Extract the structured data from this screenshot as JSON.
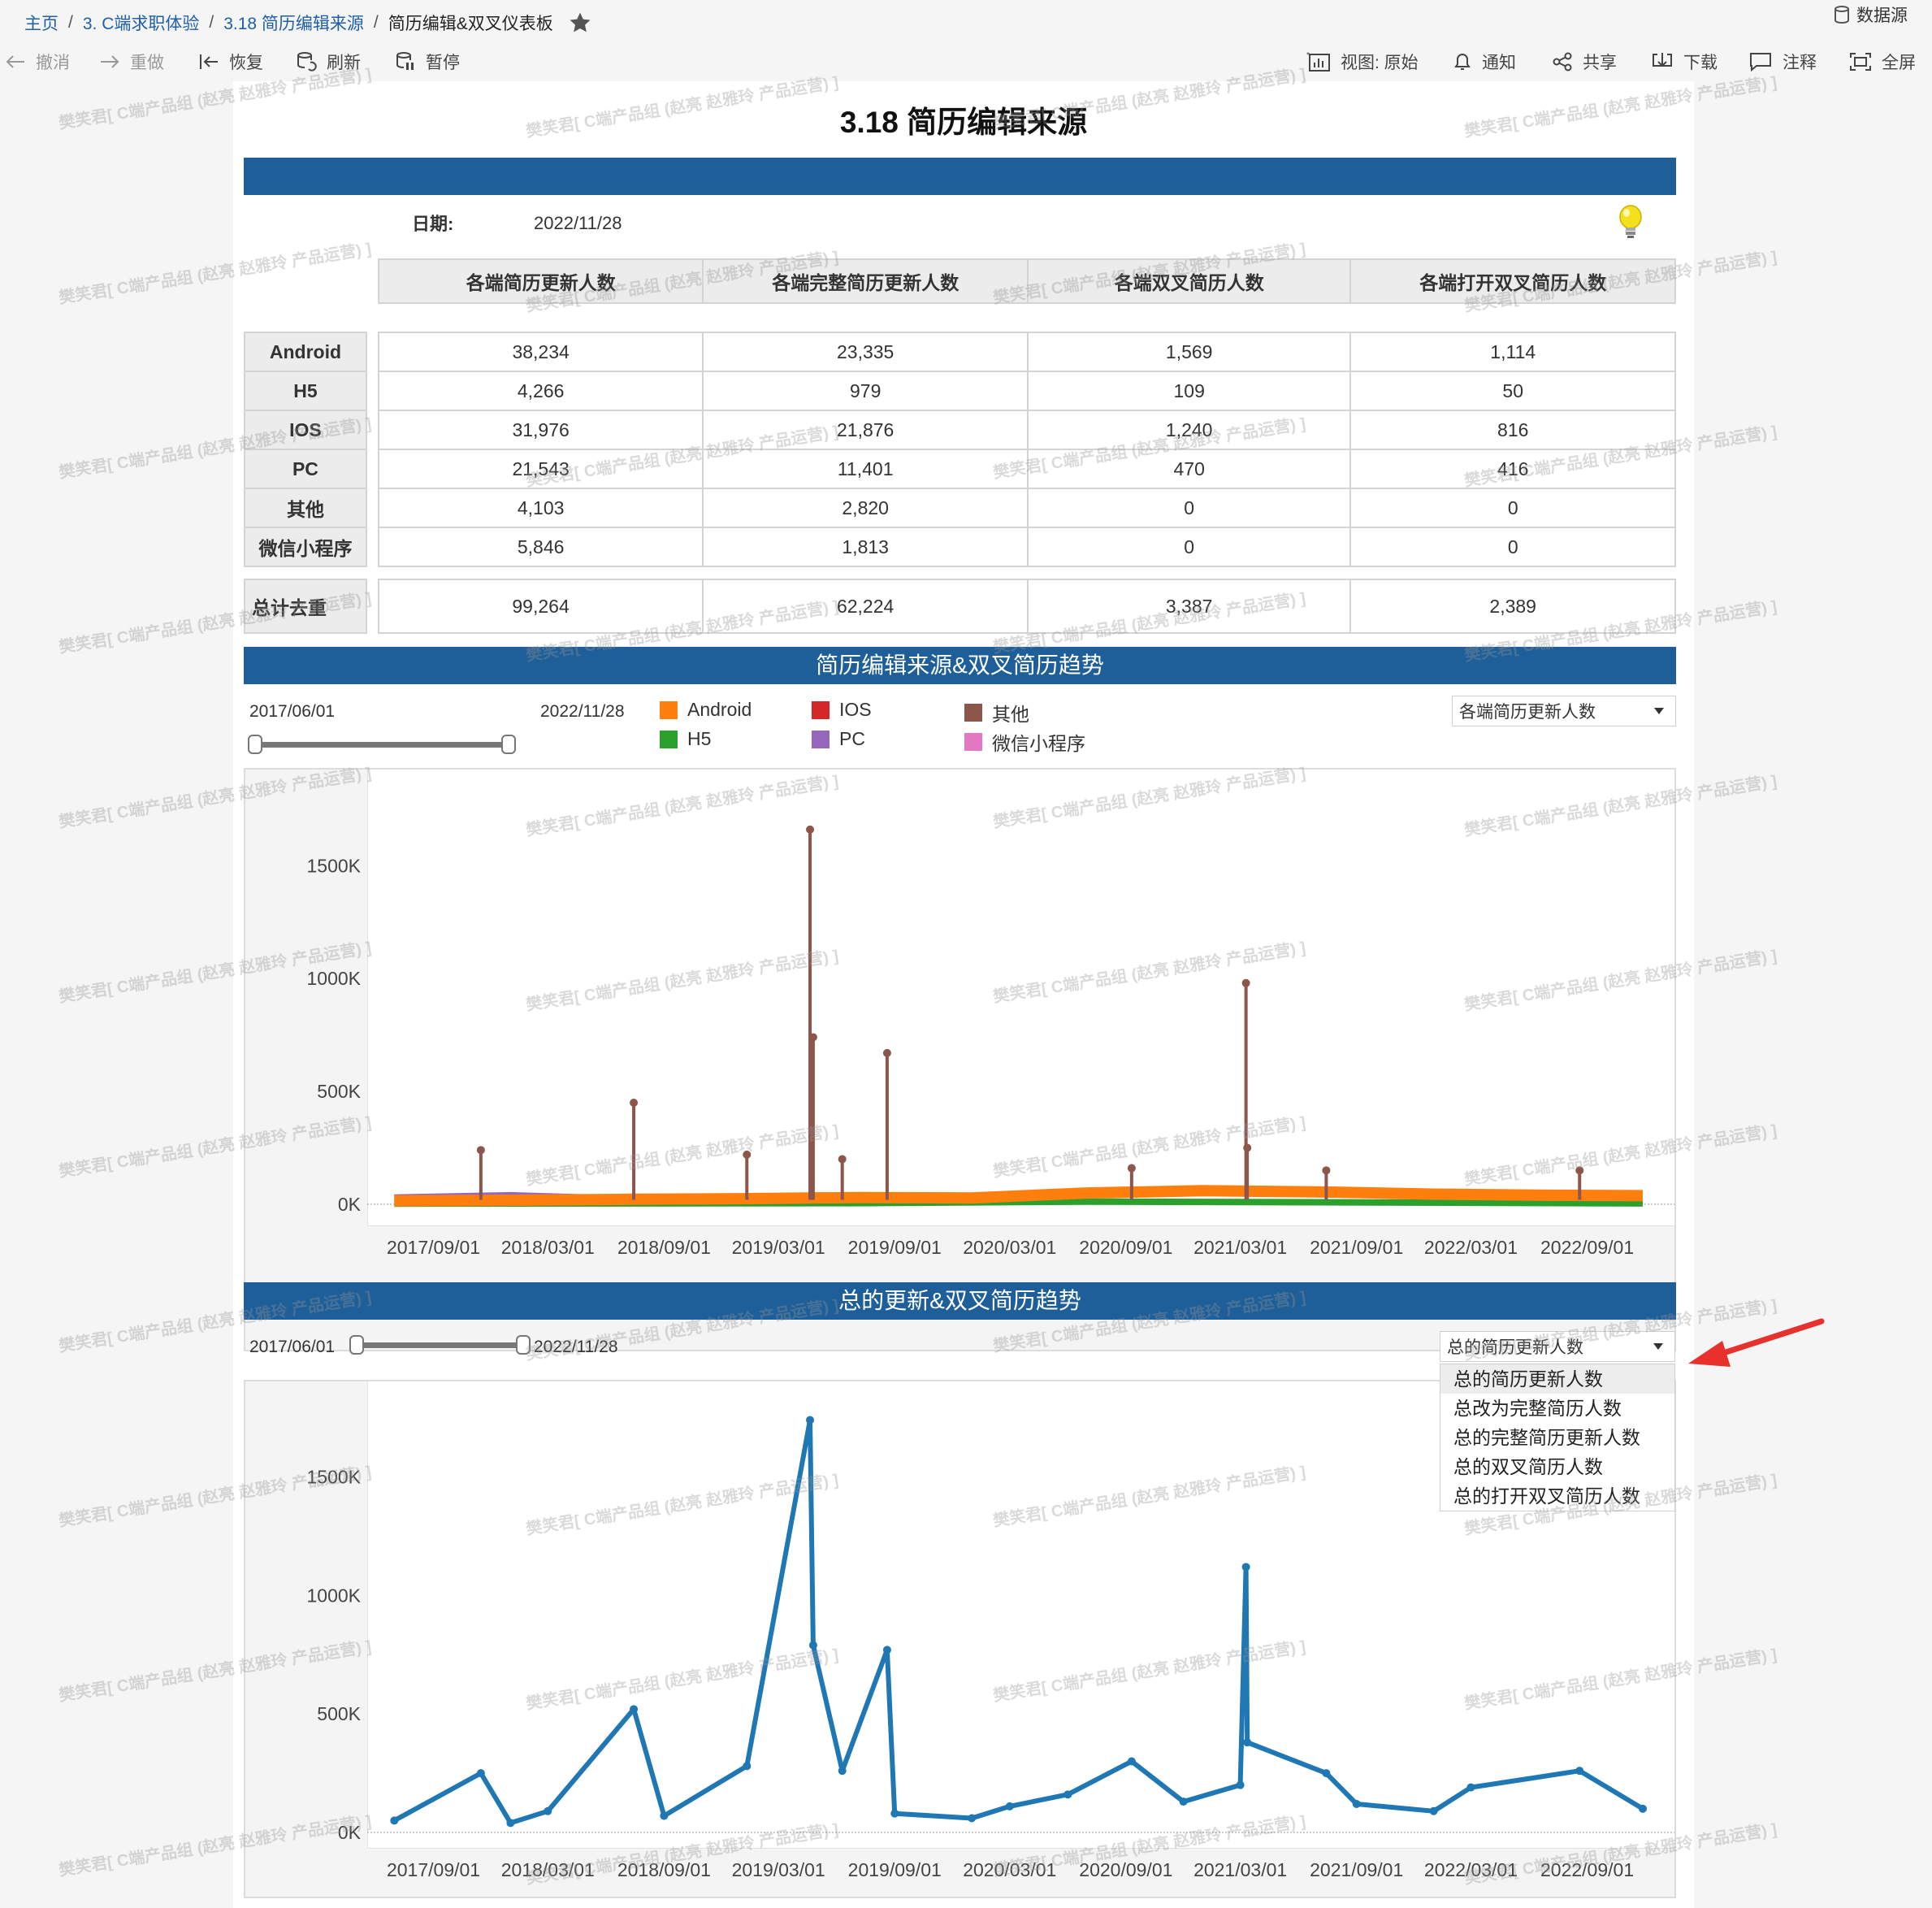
{
  "breadcrumb": {
    "items": [
      "主页",
      "3. C端求职体验",
      "3.18 简历编辑来源"
    ],
    "current": "简历编辑&双叉仪表板",
    "separator": "/"
  },
  "datasource_label": "数据源",
  "toolbar": {
    "undo": "撤消",
    "redo": "重做",
    "revert": "恢复",
    "refresh": "刷新",
    "pause": "暂停",
    "view": "视图: 原始",
    "notify": "通知",
    "share": "共享",
    "download": "下载",
    "comment": "注释",
    "fullscreen": "全屏"
  },
  "dashboard": {
    "title": "3.18 简历编辑来源",
    "date_label": "日期:",
    "date_value": "2022/11/28"
  },
  "kpi_table": {
    "columns": [
      "各端简历更新人数",
      "各端完整简历更新人数",
      "各端双叉简历人数",
      "各端打开双叉简历人数"
    ],
    "rows": [
      {
        "label": "Android",
        "values": [
          "38,234",
          "23,335",
          "1,569",
          "1,114"
        ]
      },
      {
        "label": "H5",
        "values": [
          "4,266",
          "979",
          "109",
          "50"
        ]
      },
      {
        "label": "IOS",
        "values": [
          "31,976",
          "21,876",
          "1,240",
          "816"
        ]
      },
      {
        "label": "PC",
        "values": [
          "21,543",
          "11,401",
          "470",
          "416"
        ]
      },
      {
        "label": "其他",
        "values": [
          "4,103",
          "2,820",
          "0",
          "0"
        ]
      },
      {
        "label": "微信小程序",
        "values": [
          "5,846",
          "1,813",
          "0",
          "0"
        ]
      }
    ],
    "total": {
      "label": "总计去重",
      "values": [
        "99,264",
        "62,224",
        "3,387",
        "2,389"
      ]
    }
  },
  "section1": {
    "header": "简历编辑来源&双叉简历趋势",
    "range_start": "2017/06/01",
    "range_end": "2022/11/28",
    "dropdown_value": "各端简历更新人数",
    "legend": [
      {
        "name": "Android",
        "color": "#ff7f0e"
      },
      {
        "name": "H5",
        "color": "#2ca02c"
      },
      {
        "name": "IOS",
        "color": "#d62728"
      },
      {
        "name": "PC",
        "color": "#9467bd"
      },
      {
        "name": "其他",
        "color": "#8c564b"
      },
      {
        "name": "微信小程序",
        "color": "#e377c2"
      }
    ]
  },
  "section2": {
    "header": "总的更新&双叉简历趋势",
    "range_start": "2017/06/01",
    "range_end": "2022/11/28",
    "dropdown_value": "总的简历更新人数",
    "options": [
      "总的简历更新人数",
      "总改为完整简历人数",
      "总的完整简历更新人数",
      "总的双叉简历人数",
      "总的打开双叉简历人数"
    ],
    "selected_index": 0
  },
  "watermark": "樊笑君[ C端产品组 (赵亮 赵雅玲 产品运营) ]",
  "chart_data": [
    {
      "type": "line",
      "y_ticks": [
        "0K",
        "500K",
        "1000K",
        "1500K"
      ],
      "x_ticks": [
        "2017/09/01",
        "2018/03/01",
        "2018/09/01",
        "2019/03/01",
        "2019/09/01",
        "2020/03/01",
        "2020/09/01",
        "2021/03/01",
        "2021/09/01",
        "2022/03/01",
        "2022/09/01"
      ],
      "ylim": [
        0,
        1800000
      ],
      "series_colors": {
        "Android": "#ff7f0e",
        "H5": "#2ca02c",
        "IOS": "#d62728",
        "PC": "#9467bd",
        "其他": "#8c564b",
        "微信小程序": "#e377c2"
      },
      "series": [
        {
          "name": "Android",
          "x": [
            "2017/07/01",
            "2018/01/01",
            "2018/07/01",
            "2019/01/01",
            "2019/07/01",
            "2020/01/01",
            "2020/07/01",
            "2021/01/01",
            "2021/07/01",
            "2022/01/01",
            "2022/07/01",
            "2022/11/28"
          ],
          "values": [
            15000,
            18000,
            22000,
            25000,
            30000,
            28000,
            50000,
            60000,
            55000,
            45000,
            40000,
            38000
          ]
        },
        {
          "name": "H5",
          "x": [
            "2017/07/01",
            "2018/07/01",
            "2019/07/01",
            "2020/07/01",
            "2021/07/01",
            "2022/11/28"
          ],
          "values": [
            3000,
            4000,
            5000,
            12000,
            9000,
            4000
          ]
        },
        {
          "name": "PC",
          "x": [
            "2017/07/01",
            "2018/01/01",
            "2018/07/01",
            "2019/01/01"
          ],
          "values": [
            30000,
            40000,
            25000,
            15000
          ]
        },
        {
          "name": "其他",
          "spikes": [
            {
              "x": "2017/11/15",
              "value": 240000
            },
            {
              "x": "2018/07/15",
              "value": 450000
            },
            {
              "x": "2019/01/10",
              "value": 220000
            },
            {
              "x": "2019/04/20",
              "value": 1660000
            },
            {
              "x": "2019/04/25",
              "value": 740000
            },
            {
              "x": "2019/06/10",
              "value": 200000
            },
            {
              "x": "2019/08/20",
              "value": 670000
            },
            {
              "x": "2020/09/10",
              "value": 160000
            },
            {
              "x": "2021/03/10",
              "value": 980000
            },
            {
              "x": "2021/03/12",
              "value": 250000
            },
            {
              "x": "2021/07/15",
              "value": 150000
            },
            {
              "x": "2022/08/20",
              "value": 150000
            }
          ]
        }
      ]
    },
    {
      "type": "line",
      "y_ticks": [
        "0K",
        "500K",
        "1000K",
        "1500K"
      ],
      "x_ticks": [
        "2017/09/01",
        "2018/03/01",
        "2018/09/01",
        "2019/03/01",
        "2019/09/01",
        "2020/03/01",
        "2020/09/01",
        "2021/03/01",
        "2021/09/01",
        "2022/03/01",
        "2022/09/01"
      ],
      "ylim": [
        0,
        1800000
      ],
      "series": [
        {
          "name": "总的简历更新人数",
          "color": "#1f77b4",
          "x": [
            "2017/07/01",
            "2017/11/15",
            "2018/01/01",
            "2018/03/01",
            "2018/07/15",
            "2018/09/01",
            "2019/01/10",
            "2019/04/20",
            "2019/04/25",
            "2019/06/10",
            "2019/08/20",
            "2019/09/01",
            "2020/01/01",
            "2020/03/01",
            "2020/06/01",
            "2020/09/10",
            "2020/12/01",
            "2021/03/01",
            "2021/03/10",
            "2021/03/12",
            "2021/07/15",
            "2021/09/01",
            "2022/01/01",
            "2022/03/01",
            "2022/08/20",
            "2022/11/28"
          ],
          "values": [
            50000,
            250000,
            40000,
            90000,
            520000,
            70000,
            280000,
            1740000,
            790000,
            260000,
            770000,
            80000,
            60000,
            110000,
            160000,
            300000,
            130000,
            200000,
            1120000,
            380000,
            250000,
            120000,
            90000,
            190000,
            260000,
            100000
          ]
        }
      ]
    }
  ]
}
